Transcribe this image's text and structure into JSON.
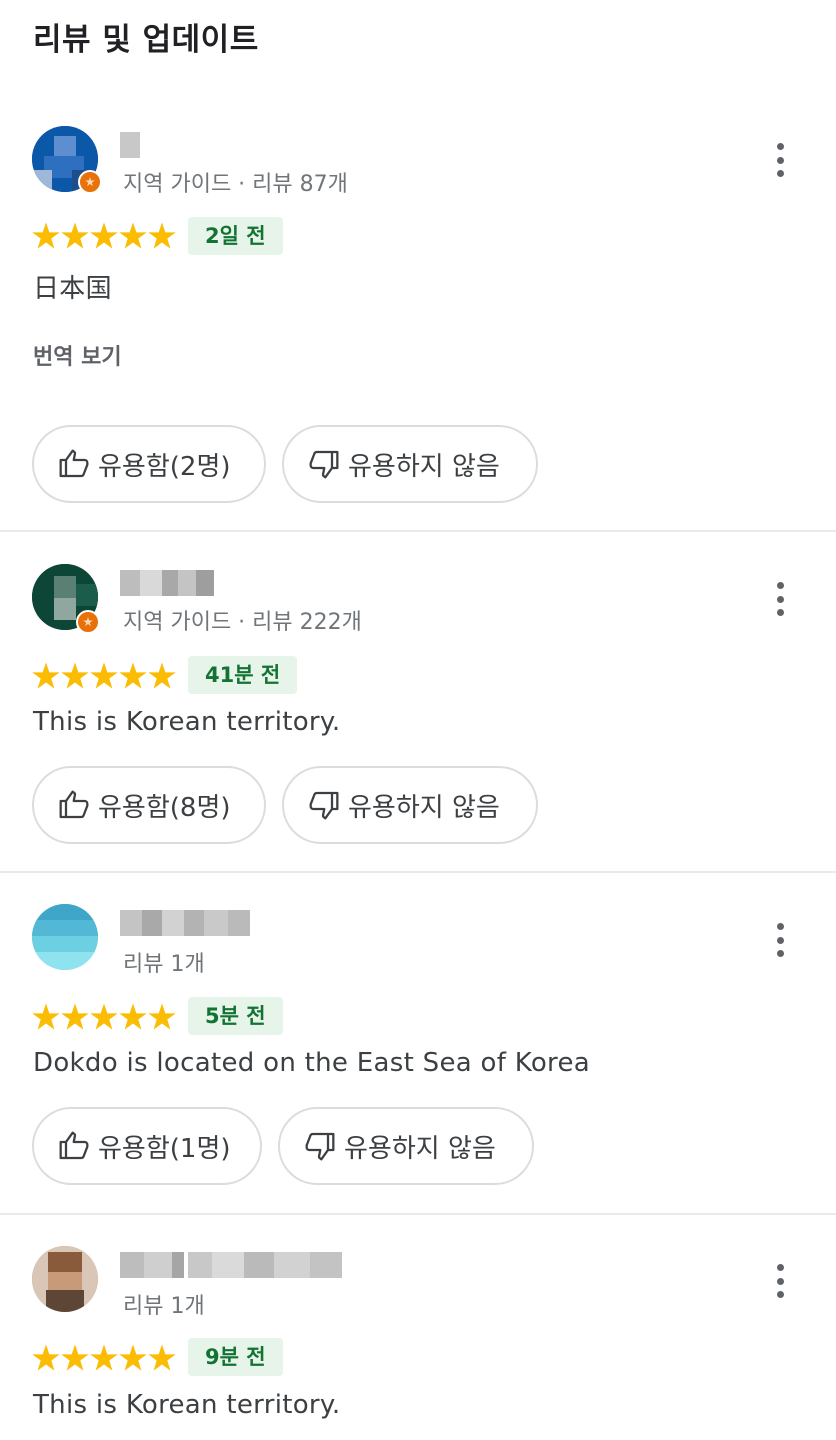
{
  "section": {
    "title": "리뷰 및 업데이트"
  },
  "colors": {
    "star": "#fbbc04",
    "time_badge_bg": "#e6f4ea",
    "time_badge_text": "#137333",
    "local_guide_badge": "#e8710a"
  },
  "icons": {
    "helpful": "thumb-up-outline-icon",
    "not_helpful": "thumb-down-outline-icon",
    "more": "more-vert-icon",
    "rating": "star-icon"
  },
  "reviews": [
    {
      "meta": "지역 가이드 · 리뷰 87개",
      "rating": 5,
      "time": "2일 전",
      "text": "日本国",
      "translate": "번역 보기",
      "helpful_label": "유용함(2명)",
      "not_helpful_label": "유용하지 않음"
    },
    {
      "meta": "지역 가이드 · 리뷰 222개",
      "rating": 5,
      "time": "41분 전",
      "text": "This is Korean territory.",
      "helpful_label": "유용함(8명)",
      "not_helpful_label": "유용하지 않음"
    },
    {
      "meta": "리뷰 1개",
      "rating": 5,
      "time": "5분 전",
      "text": "Dokdo is located on the East Sea of Korea",
      "helpful_label": "유용함(1명)",
      "not_helpful_label": "유용하지 않음"
    },
    {
      "meta": "리뷰 1개",
      "rating": 5,
      "time": "9분 전",
      "text": "This is Korean territory."
    }
  ]
}
